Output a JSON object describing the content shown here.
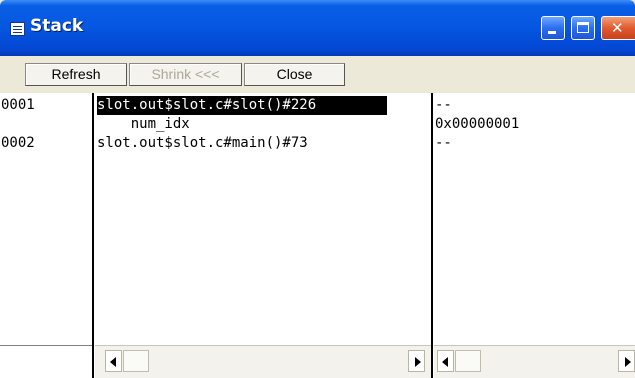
{
  "window": {
    "title": "Stack",
    "icon": "list-window-icon",
    "controls": [
      "minimize-icon",
      "maximize-icon",
      "close-icon"
    ],
    "close_glyph": "✕"
  },
  "toolbar": {
    "refresh_label": "Refresh",
    "shrink_label": "Shrink <<<",
    "close_label": "Close"
  },
  "stack": {
    "frames": [
      {
        "num": "0001",
        "name": "slot.out$slot.c#slot()#226",
        "value": "--"
      },
      {
        "num": "",
        "name": "    num_idx",
        "value": "0x00000001"
      },
      {
        "num": "0002",
        "name": "slot.out$slot.c#main()#73",
        "value": "--"
      }
    ],
    "selected_index": 0
  },
  "colors": {
    "title_bar": "#0556e0",
    "selection_bg": "#000000",
    "selection_fg": "#ffffff"
  }
}
